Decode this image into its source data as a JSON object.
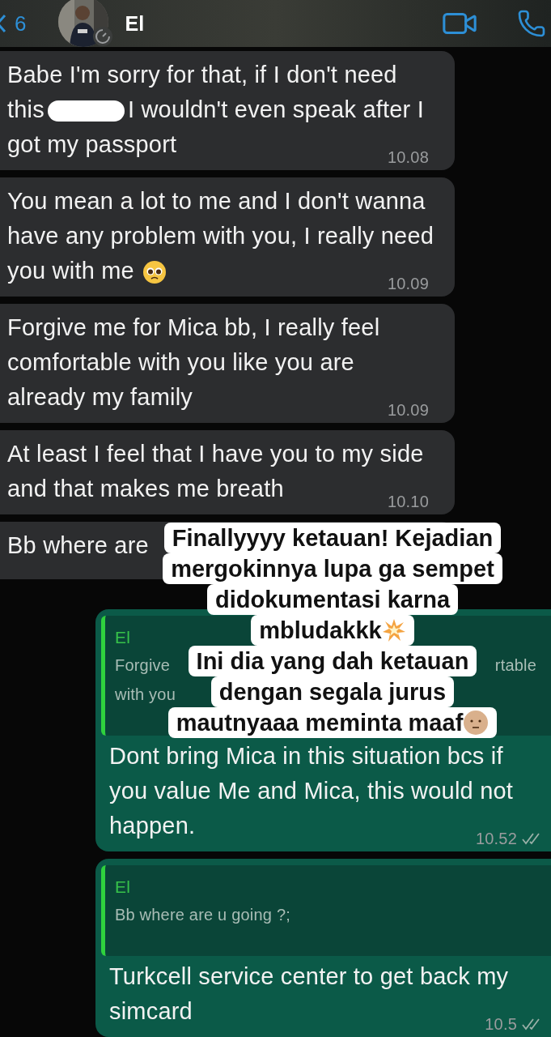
{
  "header": {
    "back_count": "6",
    "contact_name": "El"
  },
  "messages": [
    {
      "kind": "incoming",
      "text_before": "Babe I'm sorry for that, if I don't need this",
      "redacted": true,
      "text_after": "I wouldn't even speak after I got my passport",
      "time": "10.08"
    },
    {
      "kind": "incoming",
      "text_before": "You mean a lot to me and I don't wanna have any problem with you, I really need you with me",
      "emoji": {
        "kind": "pleading"
      },
      "time": "10.09"
    },
    {
      "kind": "incoming",
      "text_before": "Forgive me for Mica bb, I really feel comfortable with you like you are already my family",
      "time": "10.09"
    },
    {
      "kind": "incoming",
      "text_before": "At least I feel that I have you to my side and that makes me breath",
      "time": "10.10"
    },
    {
      "kind": "incoming",
      "text_before": "Bb where are"
    },
    {
      "kind": "outgoing",
      "quote": {
        "author": "El",
        "lines": [
          {
            "left": "Forgive",
            "right": "rtable"
          },
          {
            "left": "with you"
          }
        ]
      },
      "text_before": "Dont bring Mica in this situation bcs if you value Me and Mica, this would not happen.",
      "time": "10.52"
    },
    {
      "kind": "outgoing",
      "quote": {
        "author": "El",
        "lines": [
          {
            "left": "Bb where are u going ?;"
          }
        ]
      },
      "text_before": "Turkcell service center to get back my simcard",
      "time": "10.5"
    }
  ],
  "caption": {
    "lines": [
      {
        "text": "Finallyyyy ketauan! Kejadian"
      },
      {
        "text": "mergokinnya lupa ga sempet"
      },
      {
        "text": "didokumentasi karna"
      },
      {
        "text": "mbludakkk",
        "emoji": {
          "kind": "explosion"
        }
      },
      {
        "text": "Ini dia yang dah ketauan"
      },
      {
        "text": "dengan segala jurus"
      },
      {
        "text": "mautnyaaa meminta maaf",
        "emoji": {
          "kind": "neutral"
        }
      }
    ]
  }
}
